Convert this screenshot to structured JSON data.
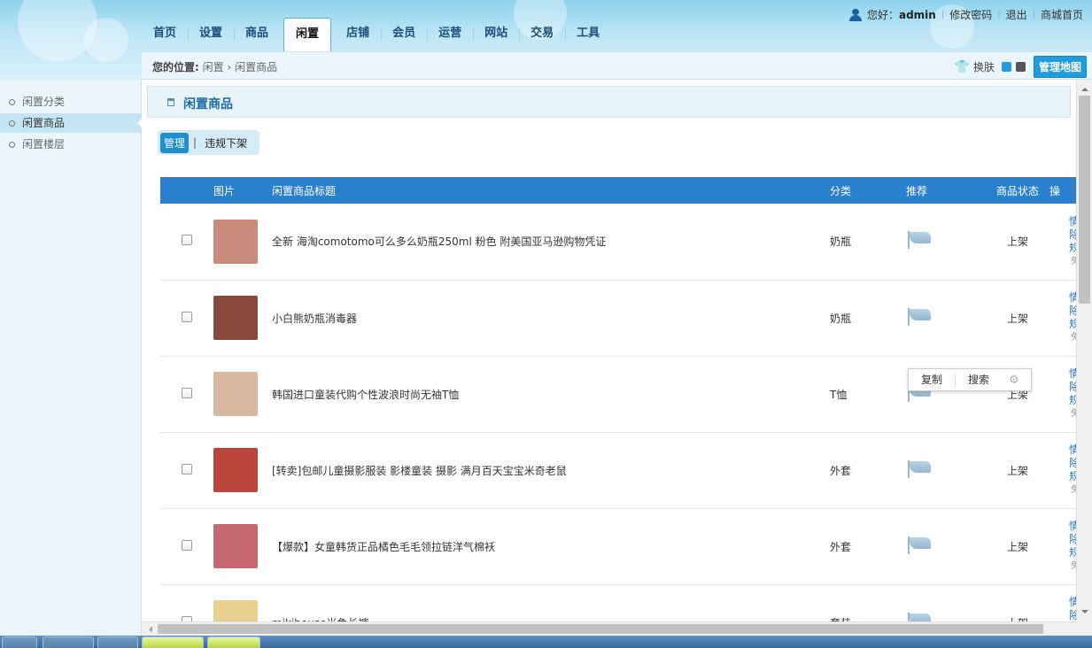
{
  "header": {
    "greeting_prefix": "您好：",
    "username": "admin",
    "links": [
      "修改密码",
      "退出",
      "商城首页"
    ]
  },
  "nav": {
    "items": [
      "首页",
      "设置",
      "商品",
      "闲置",
      "店铺",
      "会员",
      "运营",
      "网站",
      "交易",
      "工具"
    ],
    "active": "闲置"
  },
  "crumb": {
    "label": "您的位置:",
    "path": "闲置 › 闲置商品"
  },
  "skin": {
    "label": "换肤",
    "map_button": "管理地图",
    "colors": [
      "#2a9ae0",
      "#555555"
    ]
  },
  "sidebar": {
    "items": [
      {
        "label": "闲置分类",
        "active": false
      },
      {
        "label": "闲置商品",
        "active": true
      },
      {
        "label": "闲置楼层",
        "active": false
      }
    ]
  },
  "section": {
    "title": "闲置商品"
  },
  "subtabs": {
    "manage": "管理",
    "separator": "|",
    "violation": "违规下架"
  },
  "table": {
    "headers": {
      "image": "图片",
      "title": "闲置商品标题",
      "category": "分类",
      "recommend": "推荐",
      "status": "商品状态",
      "op": "操"
    },
    "rows": [
      {
        "title": "全新 海淘comotomo可么多么奶瓶250ml 粉色 附美国亚马逊购物凭证",
        "category": "奶瓶",
        "status": "上架",
        "thumb_color": "#c98b7a"
      },
      {
        "title": "小白熊奶瓶消毒器",
        "category": "奶瓶",
        "status": "上架",
        "thumb_color": "#8a4a3a"
      },
      {
        "title": "韩国进口童装代购个性波浪时尚无袖T恤",
        "category": "T恤",
        "status": "上架",
        "thumb_color": "#d9b8a0"
      },
      {
        "title": "[转卖]包邮儿童摄影服装 影楼童装 摄影 满月百天宝宝米奇老鼠",
        "category": "外套",
        "status": "上架",
        "thumb_color": "#b8443a"
      },
      {
        "title": "【爆款】女童韩货正品橘色毛毛领拉链洋气棉袄",
        "category": "外套",
        "status": "上架",
        "thumb_color": "#c76a70"
      },
      {
        "title": "mikihouse米色长裤",
        "category": "套装",
        "status": "上架",
        "thumb_color": "#e8d090"
      }
    ],
    "ops": {
      "line1": "情",
      "line2": "除",
      "line3": "规",
      "line4": "免"
    }
  },
  "context_popup": {
    "copy": "复制",
    "search": "搜索"
  }
}
